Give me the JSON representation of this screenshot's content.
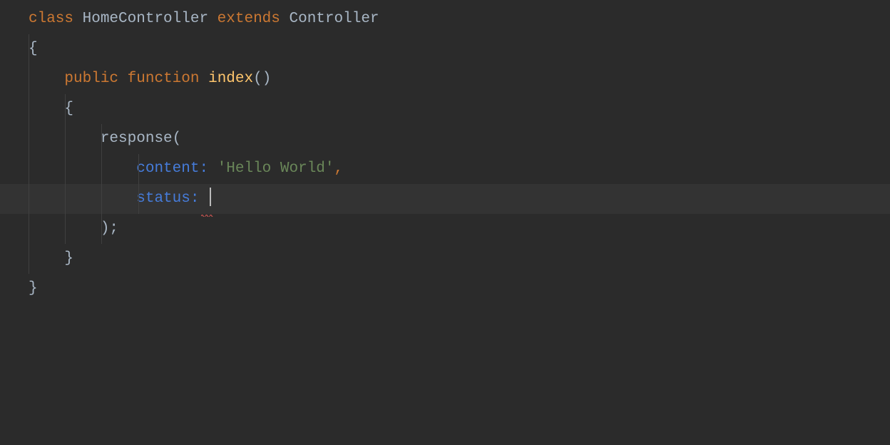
{
  "editor": {
    "language": "php",
    "theme": "darcula",
    "lines": {
      "l1": {
        "kw_class": "class",
        "class_name": "HomeController",
        "kw_extends": "extends",
        "base_class": "Controller"
      },
      "l2": {
        "brace": "{"
      },
      "l3": {
        "kw_public": "public",
        "kw_function": "function",
        "func_name": "index",
        "parens": "()"
      },
      "l4": {
        "brace": "{"
      },
      "l5": {
        "call": "response",
        "open": "("
      },
      "l6": {
        "param": "content",
        "colon": ":",
        "value": "'Hello World'",
        "comma": ","
      },
      "l7": {
        "param": "status",
        "colon": ":",
        "value": ""
      },
      "l8": {
        "close": ");"
      },
      "l9": {
        "brace": "}"
      },
      "l10": {
        "brace": "}"
      }
    },
    "indent_width": 4,
    "current_line": 7,
    "has_error_squiggle": true
  }
}
